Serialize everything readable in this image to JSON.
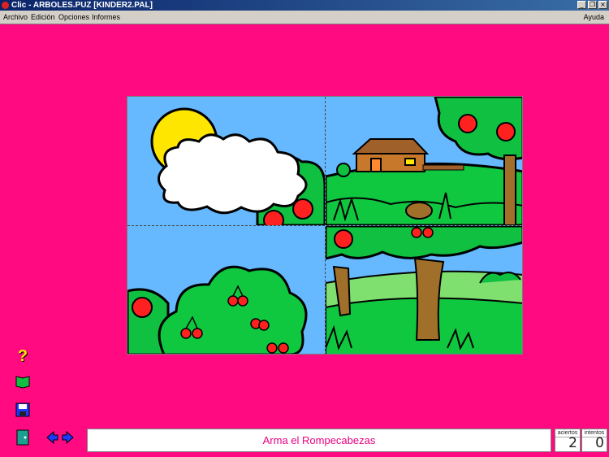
{
  "window": {
    "title": "Clic - ARBOLES.PUZ [KINDER2.PAL]"
  },
  "menu": {
    "items": [
      "Archivo",
      "Edición",
      "Opciones",
      "Informes"
    ],
    "help": "Ayuda"
  },
  "message": "Arma el Rompecabezas",
  "counters": {
    "aciertos": {
      "label": "aciertos",
      "value": "2"
    },
    "intentos": {
      "label": "intentos",
      "value": "0"
    }
  },
  "colors": {
    "background": "#ff0a80",
    "message_text": "#e80080",
    "sky": "#66b8ff",
    "grass": "#10c840"
  }
}
